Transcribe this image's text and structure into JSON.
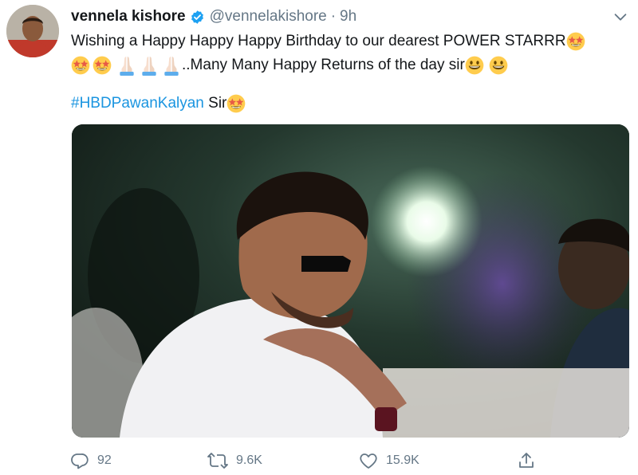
{
  "author": {
    "name": "vennela kishore",
    "handle": "@vennelakishore",
    "separator": "·",
    "time": "9h"
  },
  "tweet": {
    "line1": "Wishing a Happy Happy Happy Birthday to our dearest POWER STARRR",
    "line2": "..Many Many Happy Returns of the day sir",
    "hashtag": "#HBDPawanKalyan",
    "after_hashtag": " Sir"
  },
  "actions": {
    "replies": "92",
    "retweets": "9.6K",
    "likes": "15.9K"
  },
  "icons": {
    "verified": "verified-badge-icon",
    "more": "chevron-down-icon",
    "reply": "reply-icon",
    "retweet": "retweet-icon",
    "like": "heart-icon",
    "share": "share-icon",
    "emoji_star": "star-struck-emoji",
    "emoji_pray": "folded-hands-emoji",
    "emoji_smile": "grinning-face-emoji"
  },
  "colors": {
    "link": "#1b95e0",
    "verified": "#1da1f2",
    "muted": "#657786",
    "text": "#14171a"
  }
}
